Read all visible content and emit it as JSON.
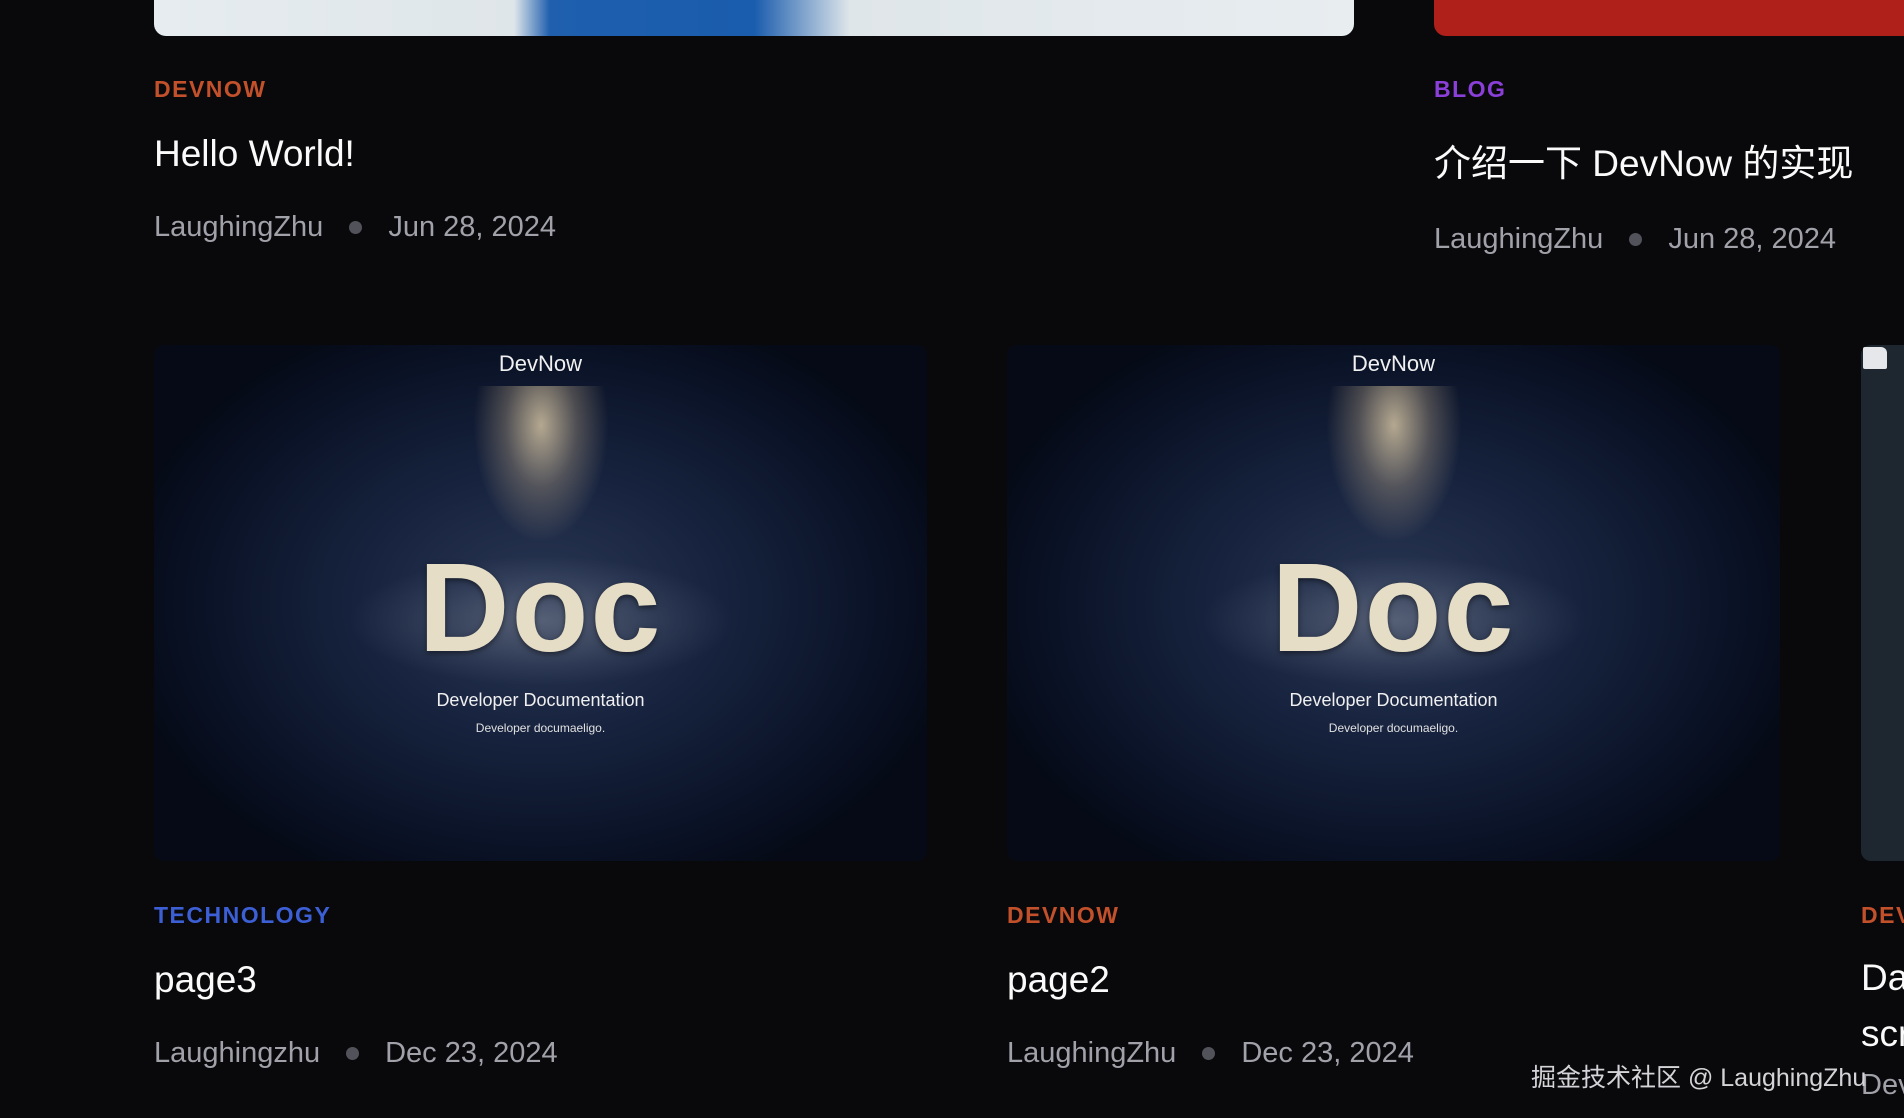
{
  "top_row": [
    {
      "category": "DEVNOW",
      "category_color": "#c2502b",
      "title": "Hello World!",
      "author": "LaughingZhu",
      "date": "Jun 28, 2024"
    },
    {
      "category": "BLOG",
      "category_color": "#8b3fd9",
      "title": "介绍一下 DevNow 的实现",
      "author": "LaughingZhu",
      "date": "Jun 28, 2024"
    }
  ],
  "bottom_row": [
    {
      "thumbnail": {
        "brand": "DevNow",
        "word": "Doc",
        "subtitle": "Developer Documentation",
        "subtitle2": "Developer documaeligo."
      },
      "category": "TECHNOLOGY",
      "category_color": "#3c5fd6",
      "title": "page3",
      "author": "Laughingzhu",
      "date": "Dec 23, 2024"
    },
    {
      "thumbnail": {
        "brand": "DevNow",
        "word": "Doc",
        "subtitle": "Developer Documentation",
        "subtitle2": "Developer documaeligo."
      },
      "category": "DEVNOW",
      "category_color": "#c2502b",
      "title": "page2",
      "author": "LaughingZhu",
      "date": "Dec 23, 2024"
    },
    {
      "category": "DEV",
      "category_color": "#c2502b",
      "title_line1": "Da",
      "title_line2": "scr",
      "author": "Dev"
    }
  ],
  "watermark": "掘金技术社区 @ LaughingZhu"
}
